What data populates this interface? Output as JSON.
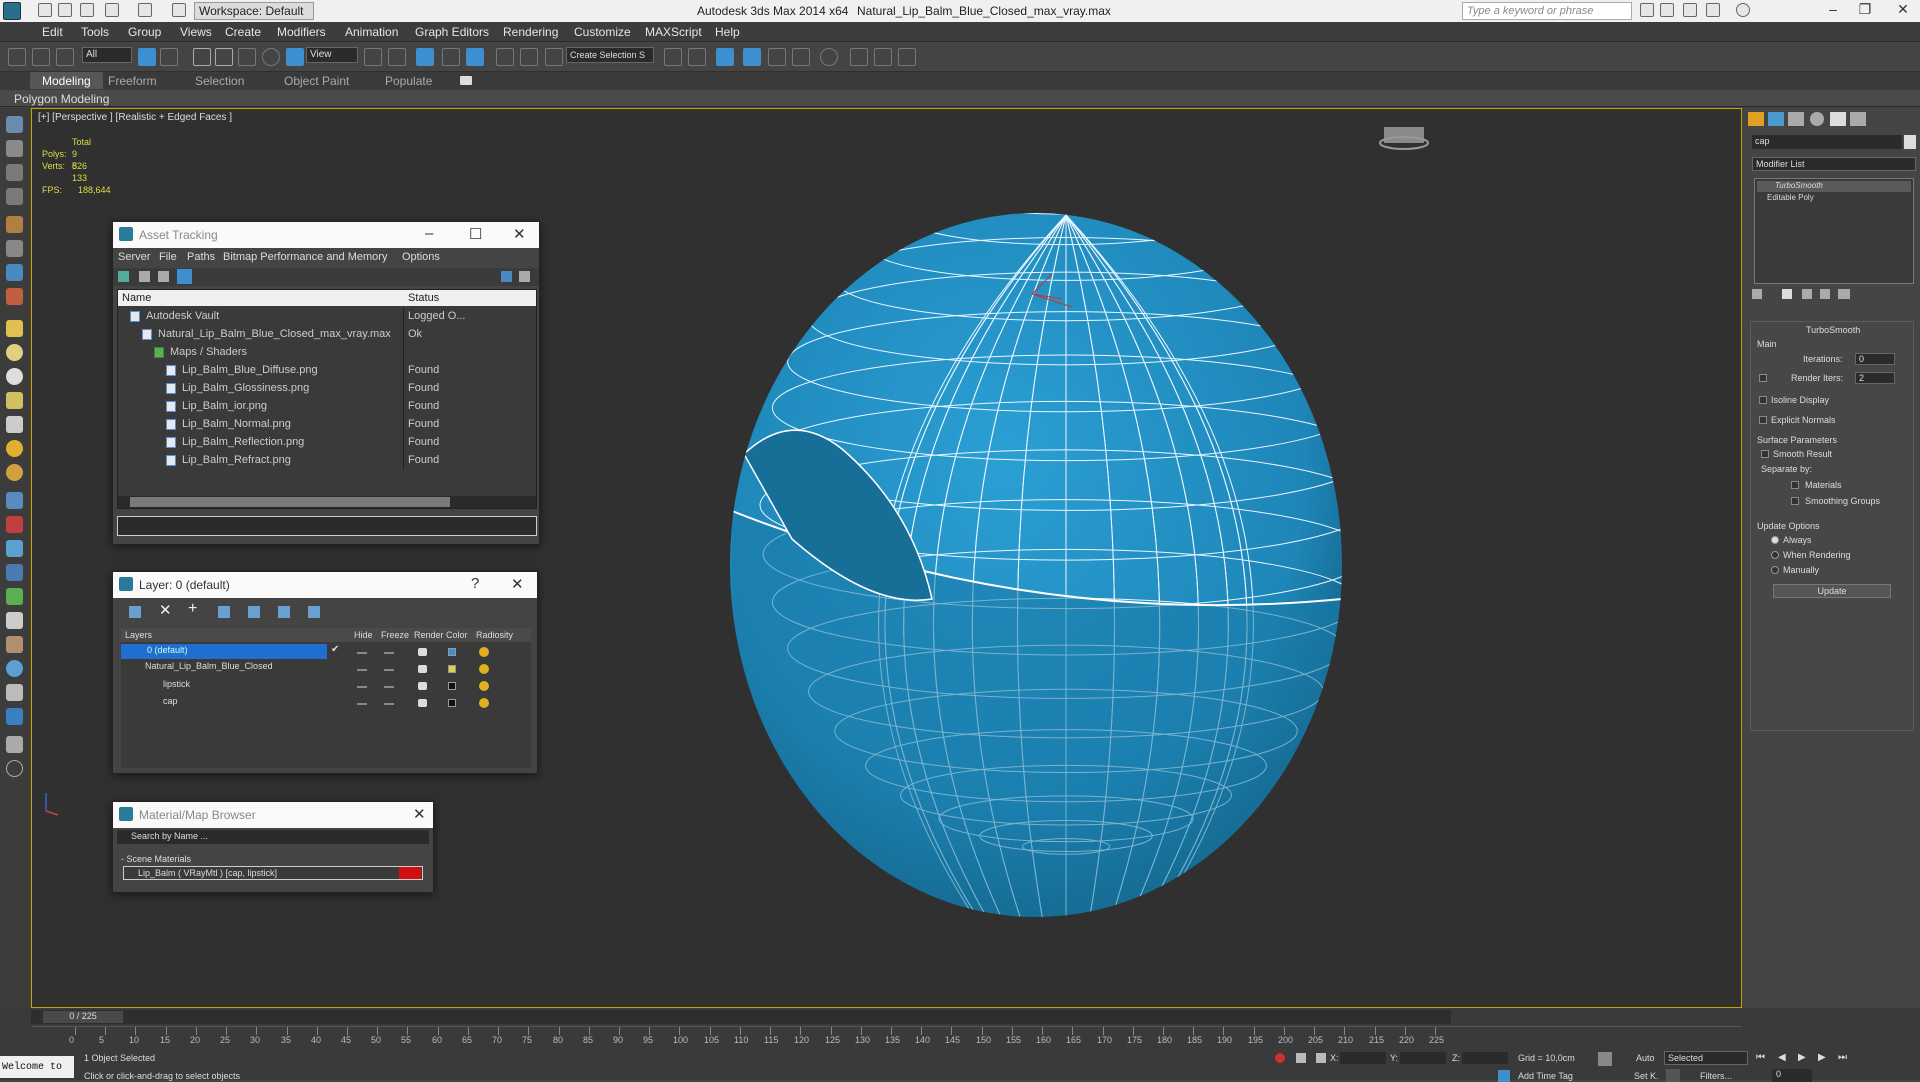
{
  "titlebar": {
    "app": "Autodesk 3ds Max  2014 x64",
    "file": "Natural_Lip_Balm_Blue_Closed_max_vray.max",
    "workspace": "Workspace: Default",
    "search_placeholder": "Type a keyword or phrase"
  },
  "menu": [
    "Edit",
    "Tools",
    "Group",
    "Views",
    "Create",
    "Modifiers",
    "Animation",
    "Graph Editors",
    "Rendering",
    "Customize",
    "MAXScript",
    "Help"
  ],
  "toolbar": {
    "filter": "All",
    "refcoord": "View",
    "selset": "Create Selection S"
  },
  "ribbon": {
    "tabs": [
      "Modeling",
      "Freeform",
      "Selection",
      "Object Paint",
      "Populate"
    ],
    "sub": "Polygon Modeling"
  },
  "viewport": {
    "label": "[+] [Perspective ] [Realistic + Edged Faces ]",
    "stats": {
      "total": "Total",
      "polys_label": "Polys:",
      "polys": "9 826",
      "verts_label": "Verts:",
      "verts": "5 133",
      "fps_label": "FPS:",
      "fps": "188,644"
    },
    "object_color": "#1e86b8"
  },
  "asset_tracking": {
    "title": "Asset Tracking",
    "menu": [
      "Server",
      "File",
      "Paths",
      "Bitmap Performance and Memory",
      "Options"
    ],
    "cols": [
      "Name",
      "Status"
    ],
    "rows": [
      {
        "name": "Autodesk Vault",
        "status": "Logged O..."
      },
      {
        "name": "Natural_Lip_Balm_Blue_Closed_max_vray.max",
        "status": "Ok"
      },
      {
        "name": "Maps / Shaders",
        "status": ""
      },
      {
        "name": "Lip_Balm_Blue_Diffuse.png",
        "status": "Found"
      },
      {
        "name": "Lip_Balm_Glossiness.png",
        "status": "Found"
      },
      {
        "name": "Lip_Balm_ior.png",
        "status": "Found"
      },
      {
        "name": "Lip_Balm_Normal.png",
        "status": "Found"
      },
      {
        "name": "Lip_Balm_Reflection.png",
        "status": "Found"
      },
      {
        "name": "Lip_Balm_Refract.png",
        "status": "Found"
      }
    ]
  },
  "layer": {
    "title": "Layer: 0 (default)",
    "help": "?",
    "cols": [
      "Layers",
      "Hide",
      "Freeze",
      "Render",
      "Color",
      "Radiosity"
    ],
    "rows": [
      {
        "name": "0 (default)"
      },
      {
        "name": "Natural_Lip_Balm_Blue_Closed"
      },
      {
        "name": "lipstick"
      },
      {
        "name": "cap"
      }
    ]
  },
  "material_browser": {
    "title": "Material/Map Browser",
    "search": "Search by Name ...",
    "group": "- Scene Materials",
    "item": "Lip_Balm  ( VRayMtl ) [cap, lipstick]"
  },
  "command_panel": {
    "name_field": "cap",
    "modifier_list": "Modifier List",
    "stack": [
      "TurboSmooth",
      "Editable Poly"
    ],
    "rollout": "TurboSmooth",
    "main": "Main",
    "iterations_label": "Iterations:",
    "iterations": "0",
    "render_iters_label": "Render Iters:",
    "render_iters": "2",
    "isoline": "Isoline Display",
    "explicit": "Explicit Normals",
    "surface": "Surface Parameters",
    "smooth_result": "Smooth Result",
    "separate": "Separate by:",
    "materials": "Materials",
    "smoothing": "Smoothing Groups",
    "update_opts": "Update Options",
    "always": "Always",
    "when_rendering": "When Rendering",
    "manually": "Manually",
    "update_btn": "Update"
  },
  "timeline": {
    "frame": "0 / 225",
    "ticks": [
      "0",
      "5",
      "10",
      "15",
      "20",
      "25",
      "30",
      "35",
      "40",
      "45",
      "50",
      "55",
      "60",
      "65",
      "70",
      "75",
      "80",
      "85",
      "90",
      "95",
      "100",
      "105",
      "110",
      "115",
      "120",
      "125",
      "130",
      "135",
      "140",
      "145",
      "150",
      "155",
      "160",
      "165",
      "170",
      "175",
      "180",
      "185",
      "190",
      "195",
      "200",
      "205",
      "210",
      "215",
      "220",
      "225"
    ]
  },
  "status": {
    "welcome": "Welcome to",
    "selected": "1 Object Selected",
    "hint": "Click or click-and-drag to select objects",
    "grid": "Grid = 10,0cm",
    "addtime": "Add Time Tag",
    "auto": "Auto",
    "setk": "Set K.",
    "selected_dd": "Selected",
    "filters": "Filters...",
    "x": "X:",
    "y": "Y:",
    "z": "Z:",
    "frame_field": "0"
  }
}
